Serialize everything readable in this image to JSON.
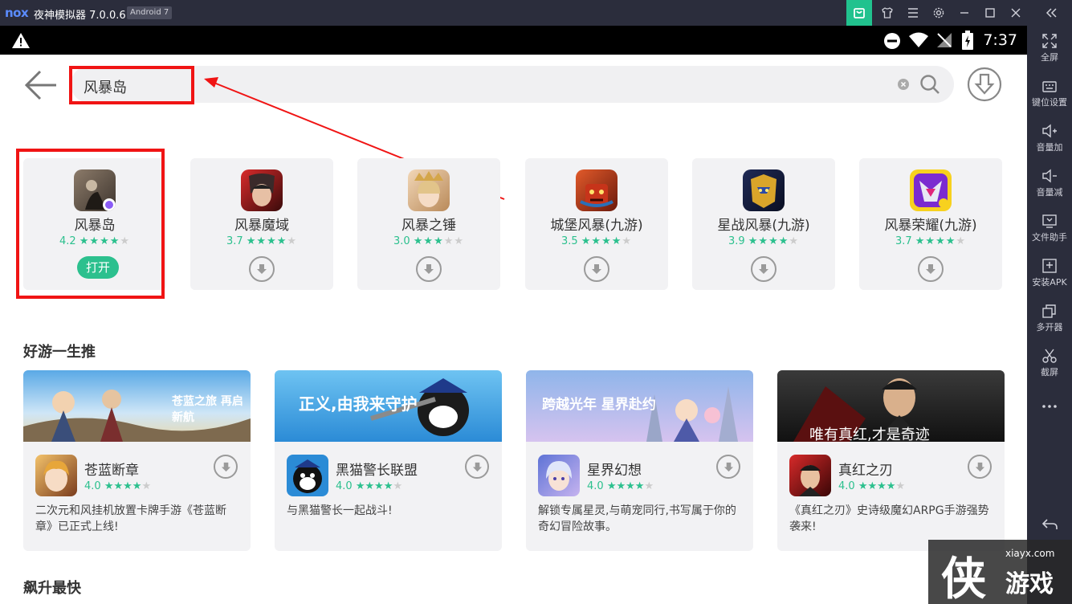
{
  "window": {
    "logo": "nox",
    "title": "夜神模拟器 7.0.0.6",
    "android_badge": "Android 7",
    "colors": {
      "titlebar": "#2b2d3c",
      "accent": "#21c28e"
    }
  },
  "statusbar": {
    "time": "7:37"
  },
  "sidebar": {
    "items": [
      {
        "label": "全屏",
        "icon": "fullscreen-icon"
      },
      {
        "label": "键位设置",
        "icon": "keyboard-icon"
      },
      {
        "label": "音量加",
        "icon": "volume-up-icon"
      },
      {
        "label": "音量减",
        "icon": "volume-down-icon"
      },
      {
        "label": "文件助手",
        "icon": "file-helper-icon"
      },
      {
        "label": "安装APK",
        "icon": "install-apk-icon"
      },
      {
        "label": "多开器",
        "icon": "multi-instance-icon"
      },
      {
        "label": "截屏",
        "icon": "screenshot-icon"
      }
    ]
  },
  "search": {
    "query": "风暴岛"
  },
  "results": [
    {
      "name": "风暴岛",
      "rating": "4.2",
      "stars": 4,
      "action": "打开"
    },
    {
      "name": "风暴魔域",
      "rating": "3.7",
      "stars": 3.5
    },
    {
      "name": "风暴之锤",
      "rating": "3.0",
      "stars": 3
    },
    {
      "name": "城堡风暴(九游)",
      "rating": "3.5",
      "stars": 3.5
    },
    {
      "name": "星战风暴(九游)",
      "rating": "3.9",
      "stars": 4
    },
    {
      "name": "风暴荣耀(九游)",
      "rating": "3.7",
      "stars": 3.5
    }
  ],
  "sections": {
    "recommend_title": "好游一生推",
    "next_title": "飙升最快"
  },
  "games": [
    {
      "name": "苍蓝断章",
      "rating": "4.0",
      "desc": "二次元和风挂机放置卡牌手游《苍蓝断章》已正式上线!",
      "banner_text": "苍蓝之旅 再启新航"
    },
    {
      "name": "黑猫警长联盟",
      "rating": "4.0",
      "desc": "与黑猫警长一起战斗!",
      "banner_text": "正义,由我来守护"
    },
    {
      "name": "星界幻想",
      "rating": "4.0",
      "desc": "解锁专属星灵,与萌宠同行,书写属于你的奇幻冒险故事。",
      "banner_text": "跨越光年 星界赴约"
    },
    {
      "name": "真红之刃",
      "rating": "4.0",
      "desc": "《真红之刃》史诗级魔幻ARPG手游强势袭来!",
      "banner_text": "唯有真红,才是奇迹"
    }
  ],
  "watermark": {
    "url": "xiayx.com",
    "big": "侠",
    "word": "游戏"
  }
}
